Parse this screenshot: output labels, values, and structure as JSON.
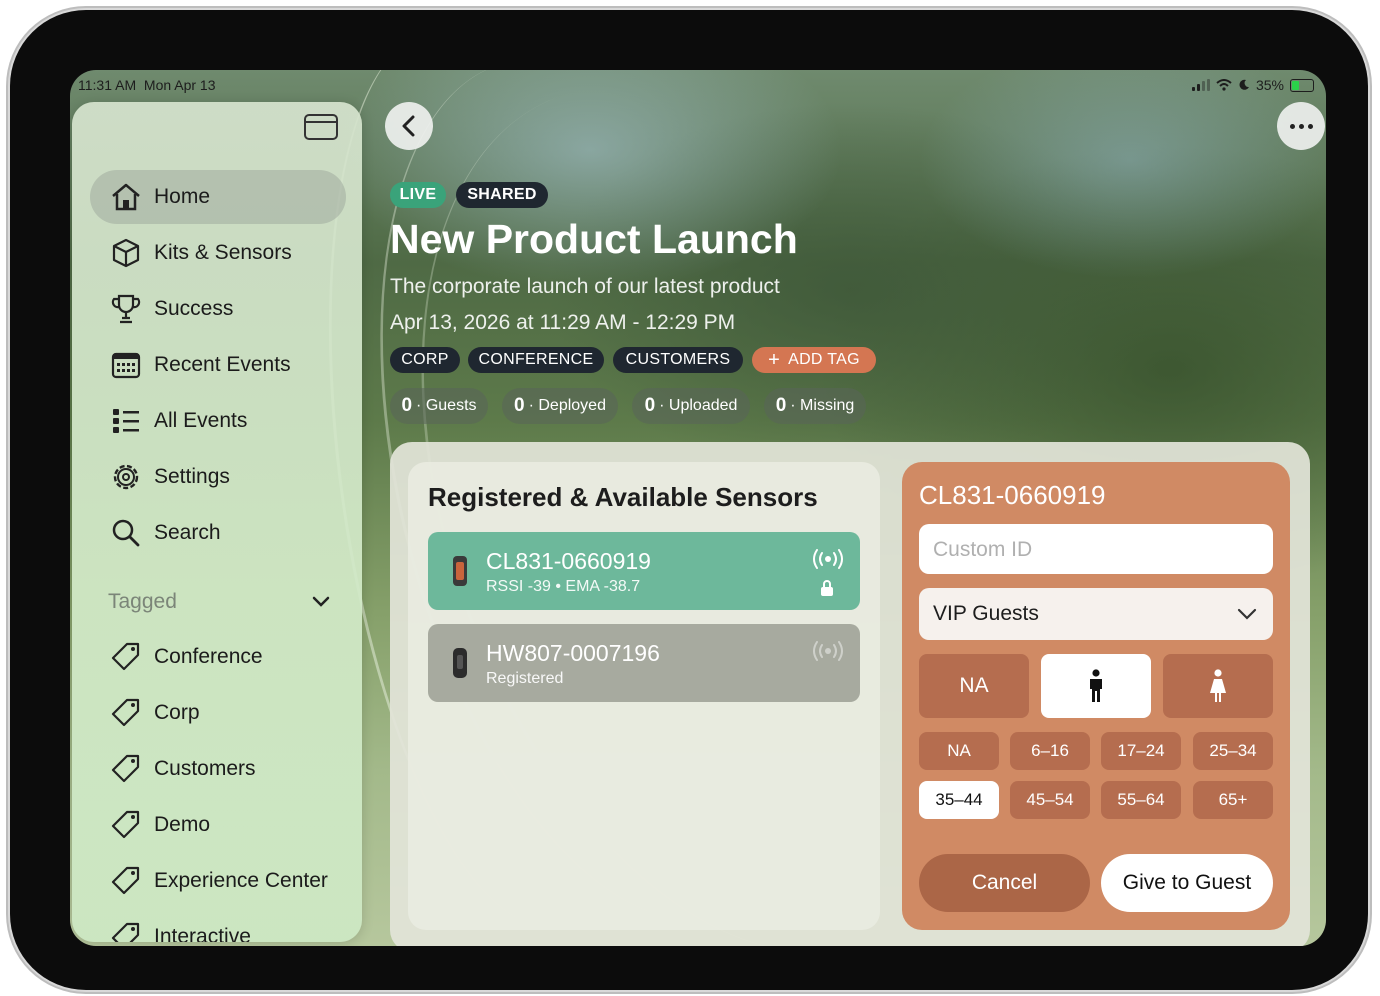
{
  "status_bar": {
    "time": "11:31 AM",
    "date": "Mon Apr 13",
    "battery": "35%"
  },
  "sidebar": {
    "items": [
      {
        "label": "Home",
        "icon": "home-icon"
      },
      {
        "label": "Kits & Sensors",
        "icon": "cube-icon"
      },
      {
        "label": "Success",
        "icon": "trophy-icon"
      },
      {
        "label": "Recent Events",
        "icon": "calendar-icon"
      },
      {
        "label": "All Events",
        "icon": "list-icon"
      },
      {
        "label": "Settings",
        "icon": "gear-icon"
      },
      {
        "label": "Search",
        "icon": "search-icon"
      }
    ],
    "tagged_label": "Tagged",
    "tags": [
      "Conference",
      "Corp",
      "Customers",
      "Demo",
      "Experience Center",
      "Interactive"
    ]
  },
  "event": {
    "badges": {
      "live": "LIVE",
      "shared": "SHARED"
    },
    "title": "New Product Launch",
    "subtitle": "The corporate launch of our latest product",
    "datetime": "Apr 13, 2026 at 11:29 AM - 12:29 PM",
    "tags": [
      "CORP",
      "CONFERENCE",
      "CUSTOMERS"
    ],
    "add_tag": "ADD TAG",
    "stats": [
      {
        "count": "0",
        "label": "· Guests"
      },
      {
        "count": "0",
        "label": "· Deployed"
      },
      {
        "count": "0",
        "label": "· Uploaded"
      },
      {
        "count": "0",
        "label": "· Missing"
      }
    ]
  },
  "sensors": {
    "title": "Registered & Available Sensors",
    "list": [
      {
        "name": "CL831-0660919",
        "sub": "RSSI -39 • EMA -38.7"
      },
      {
        "name": "HW807-0007196",
        "sub": "Registered"
      }
    ]
  },
  "guest_form": {
    "sensor_id": "CL831-0660919",
    "custom_id_placeholder": "Custom ID",
    "group": "VIP Guests",
    "gender": {
      "na": "NA",
      "selected": "male"
    },
    "ages": [
      "NA",
      "6–16",
      "17–24",
      "25–34",
      "35–44",
      "45–54",
      "55–64",
      "65+"
    ],
    "selected_age": "35–44",
    "cancel": "Cancel",
    "give": "Give to Guest"
  },
  "colors": {
    "live": "#3aa37a",
    "accent": "#d47652",
    "card": "#d08a64",
    "sensor_active": "#6db89b"
  }
}
